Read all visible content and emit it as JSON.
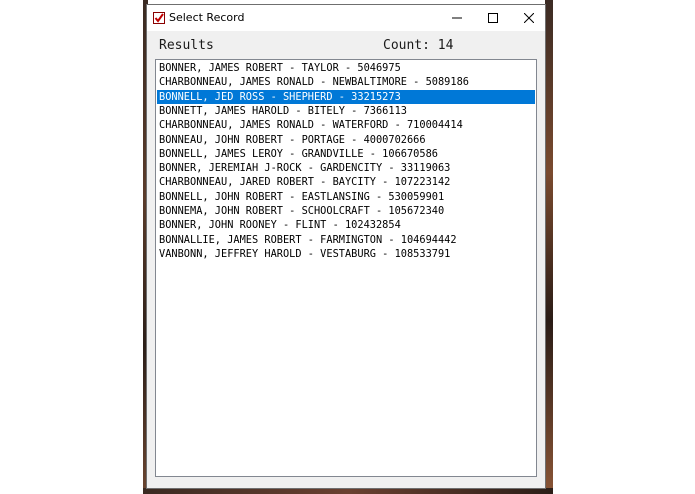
{
  "window": {
    "title": "Select Record"
  },
  "header": {
    "results_label": "Results",
    "count_label": "Count:",
    "count_value": "14"
  },
  "list": {
    "selected_index": 2,
    "items": [
      "BONNER, JAMES ROBERT - TAYLOR - 5046975",
      "CHARBONNEAU, JAMES RONALD - NEWBALTIMORE - 5089186",
      "BONNELL, JED ROSS - SHEPHERD - 33215273",
      "BONNETT, JAMES HAROLD - BITELY - 7366113",
      "CHARBONNEAU, JAMES RONALD - WATERFORD - 710004414",
      "BONNEAU, JOHN ROBERT - PORTAGE - 4000702666",
      "BONNELL, JAMES LEROY - GRANDVILLE - 106670586",
      "BONNER, JEREMIAH J-ROCK - GARDENCITY - 33119063",
      "CHARBONNEAU, JARED ROBERT - BAYCITY - 107223142",
      "BONNELL, JOHN ROBERT - EASTLANSING - 530059901",
      "BONNEMA, JOHN ROBERT - SCHOOLCRAFT - 105672340",
      "BONNER, JOHN ROONEY - FLINT - 102432854",
      "BONNALLIE, JAMES ROBERT - FARMINGTON - 104694442",
      "VANBONN, JEFFREY HAROLD - VESTABURG - 108533791"
    ]
  },
  "colors": {
    "selection": "#0078d7",
    "window_bg": "#f0f0f0",
    "title_bar": "#ffffff",
    "icon_red": "#c00000"
  },
  "icons": {
    "app": "checkbox-icon",
    "minimize": "minimize-icon",
    "maximize": "maximize-icon",
    "close": "close-icon"
  }
}
